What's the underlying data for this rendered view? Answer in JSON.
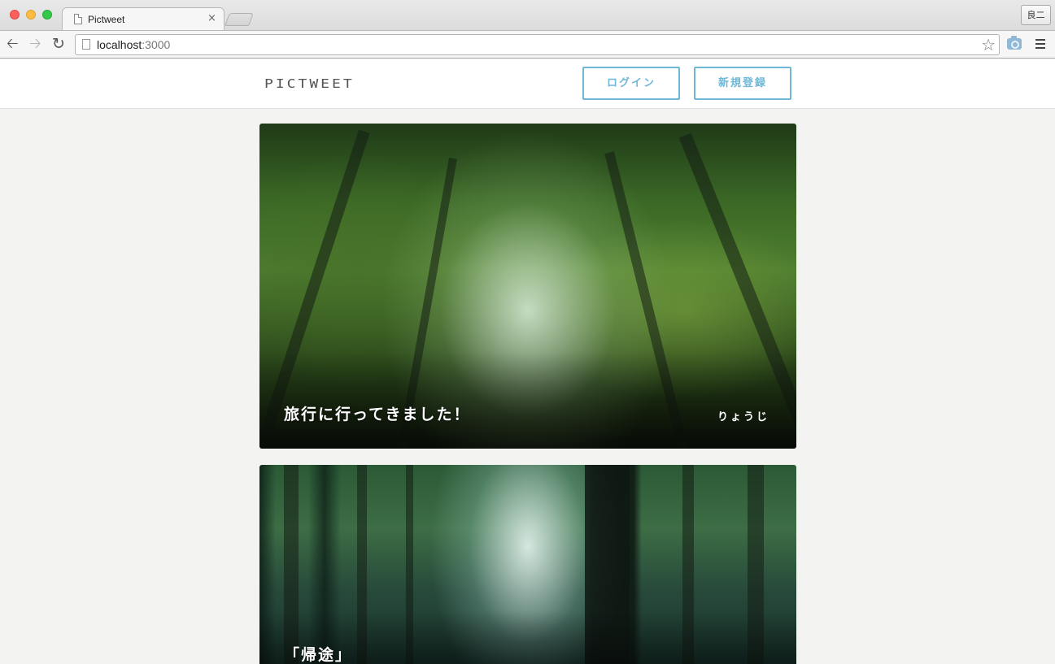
{
  "browser": {
    "tab_title": "Pictweet",
    "tab_close": "×",
    "profile_label": "良二",
    "url_host": "localhost",
    "url_port": ":3000",
    "icons": [
      "back-arrow-icon",
      "forward-arrow-icon",
      "reload-icon",
      "page-icon",
      "star-icon",
      "camera-icon",
      "menu-icon"
    ]
  },
  "header": {
    "logo": "PICTWEET",
    "login_label": "ログイン",
    "signup_label": "新規登録",
    "accent_color": "#6fb7d6"
  },
  "tweets": [
    {
      "text": "旅行に行ってきました！",
      "user": "りょうじ"
    },
    {
      "text": "「帰途」"
    }
  ]
}
